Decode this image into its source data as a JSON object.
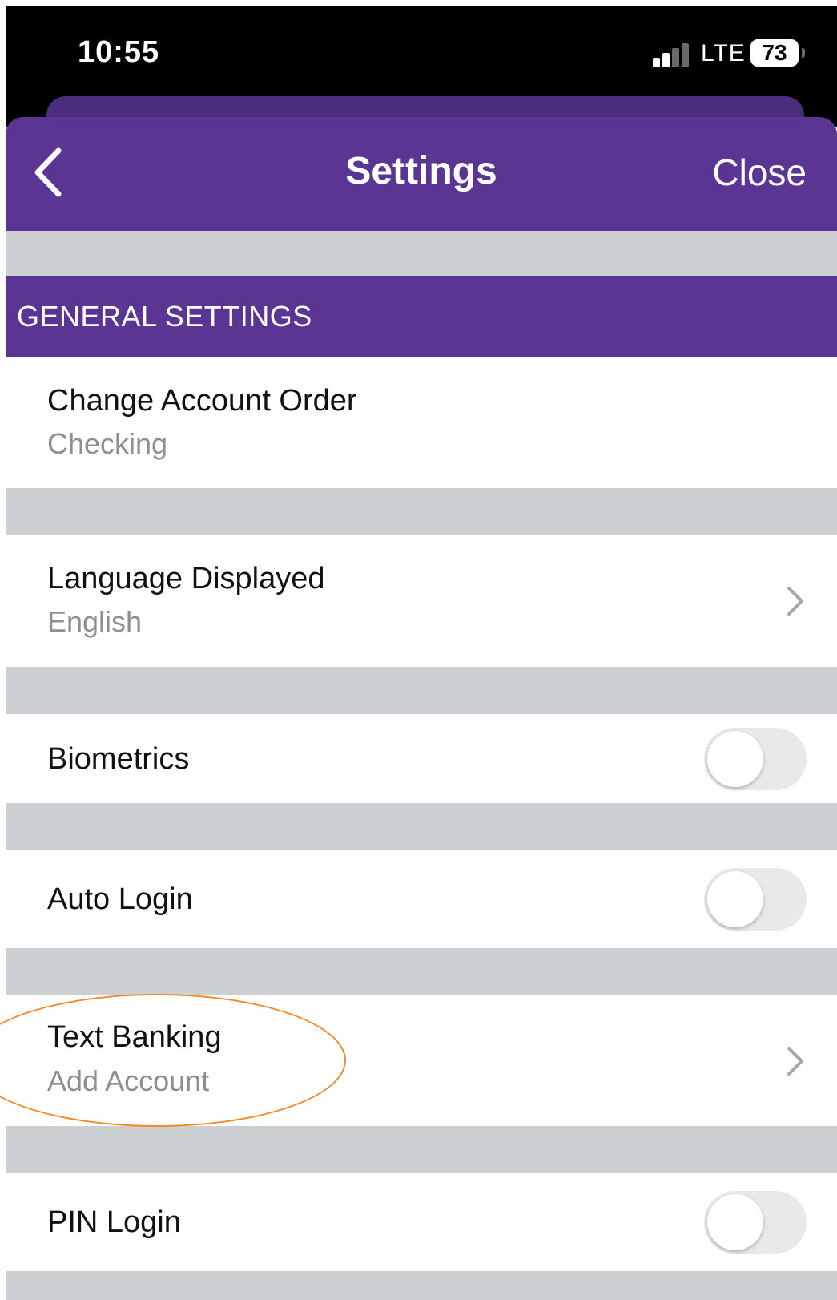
{
  "status_bar": {
    "time": "10:55",
    "network": "LTE",
    "battery": "73",
    "signal_bars_active": 2,
    "signal_bars_total": 4
  },
  "header": {
    "title": "Settings",
    "close_label": "Close",
    "back_icon": "chevron-left-icon"
  },
  "section": {
    "title": "GENERAL SETTINGS"
  },
  "rows": {
    "account_order": {
      "title": "Change Account Order",
      "subtitle": "Checking"
    },
    "language": {
      "title": "Language Displayed",
      "subtitle": "English"
    },
    "biometrics": {
      "title": "Biometrics",
      "enabled": false
    },
    "auto_login": {
      "title": "Auto Login",
      "enabled": false
    },
    "text_banking": {
      "title": "Text Banking",
      "subtitle": "Add Account"
    },
    "pin_login": {
      "title": "PIN Login",
      "enabled": false
    }
  },
  "colors": {
    "brand_purple": "#5a3594",
    "separator_gray": "#cdd0d2",
    "annotation_orange": "#f08a2c"
  }
}
